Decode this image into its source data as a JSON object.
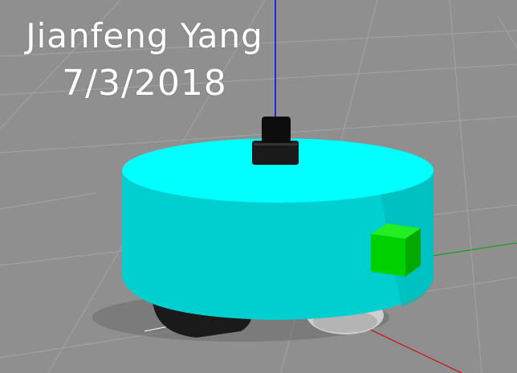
{
  "overlay": {
    "name": "Jianfeng Yang",
    "date": "7/3/2018"
  },
  "colors": {
    "ground": "#8f8f8f",
    "grid_line": "#a3a3a3",
    "chassis_top": "#00ffff",
    "chassis_side": "#00cccc",
    "sensor_box": "#00cc00",
    "lidar": "#111111",
    "wheel": "#1b1b1b",
    "caster": "#d8d8d8",
    "axis_z": "#0000ff",
    "axis_x": "#ff0000",
    "axis_y": "#00a000"
  }
}
